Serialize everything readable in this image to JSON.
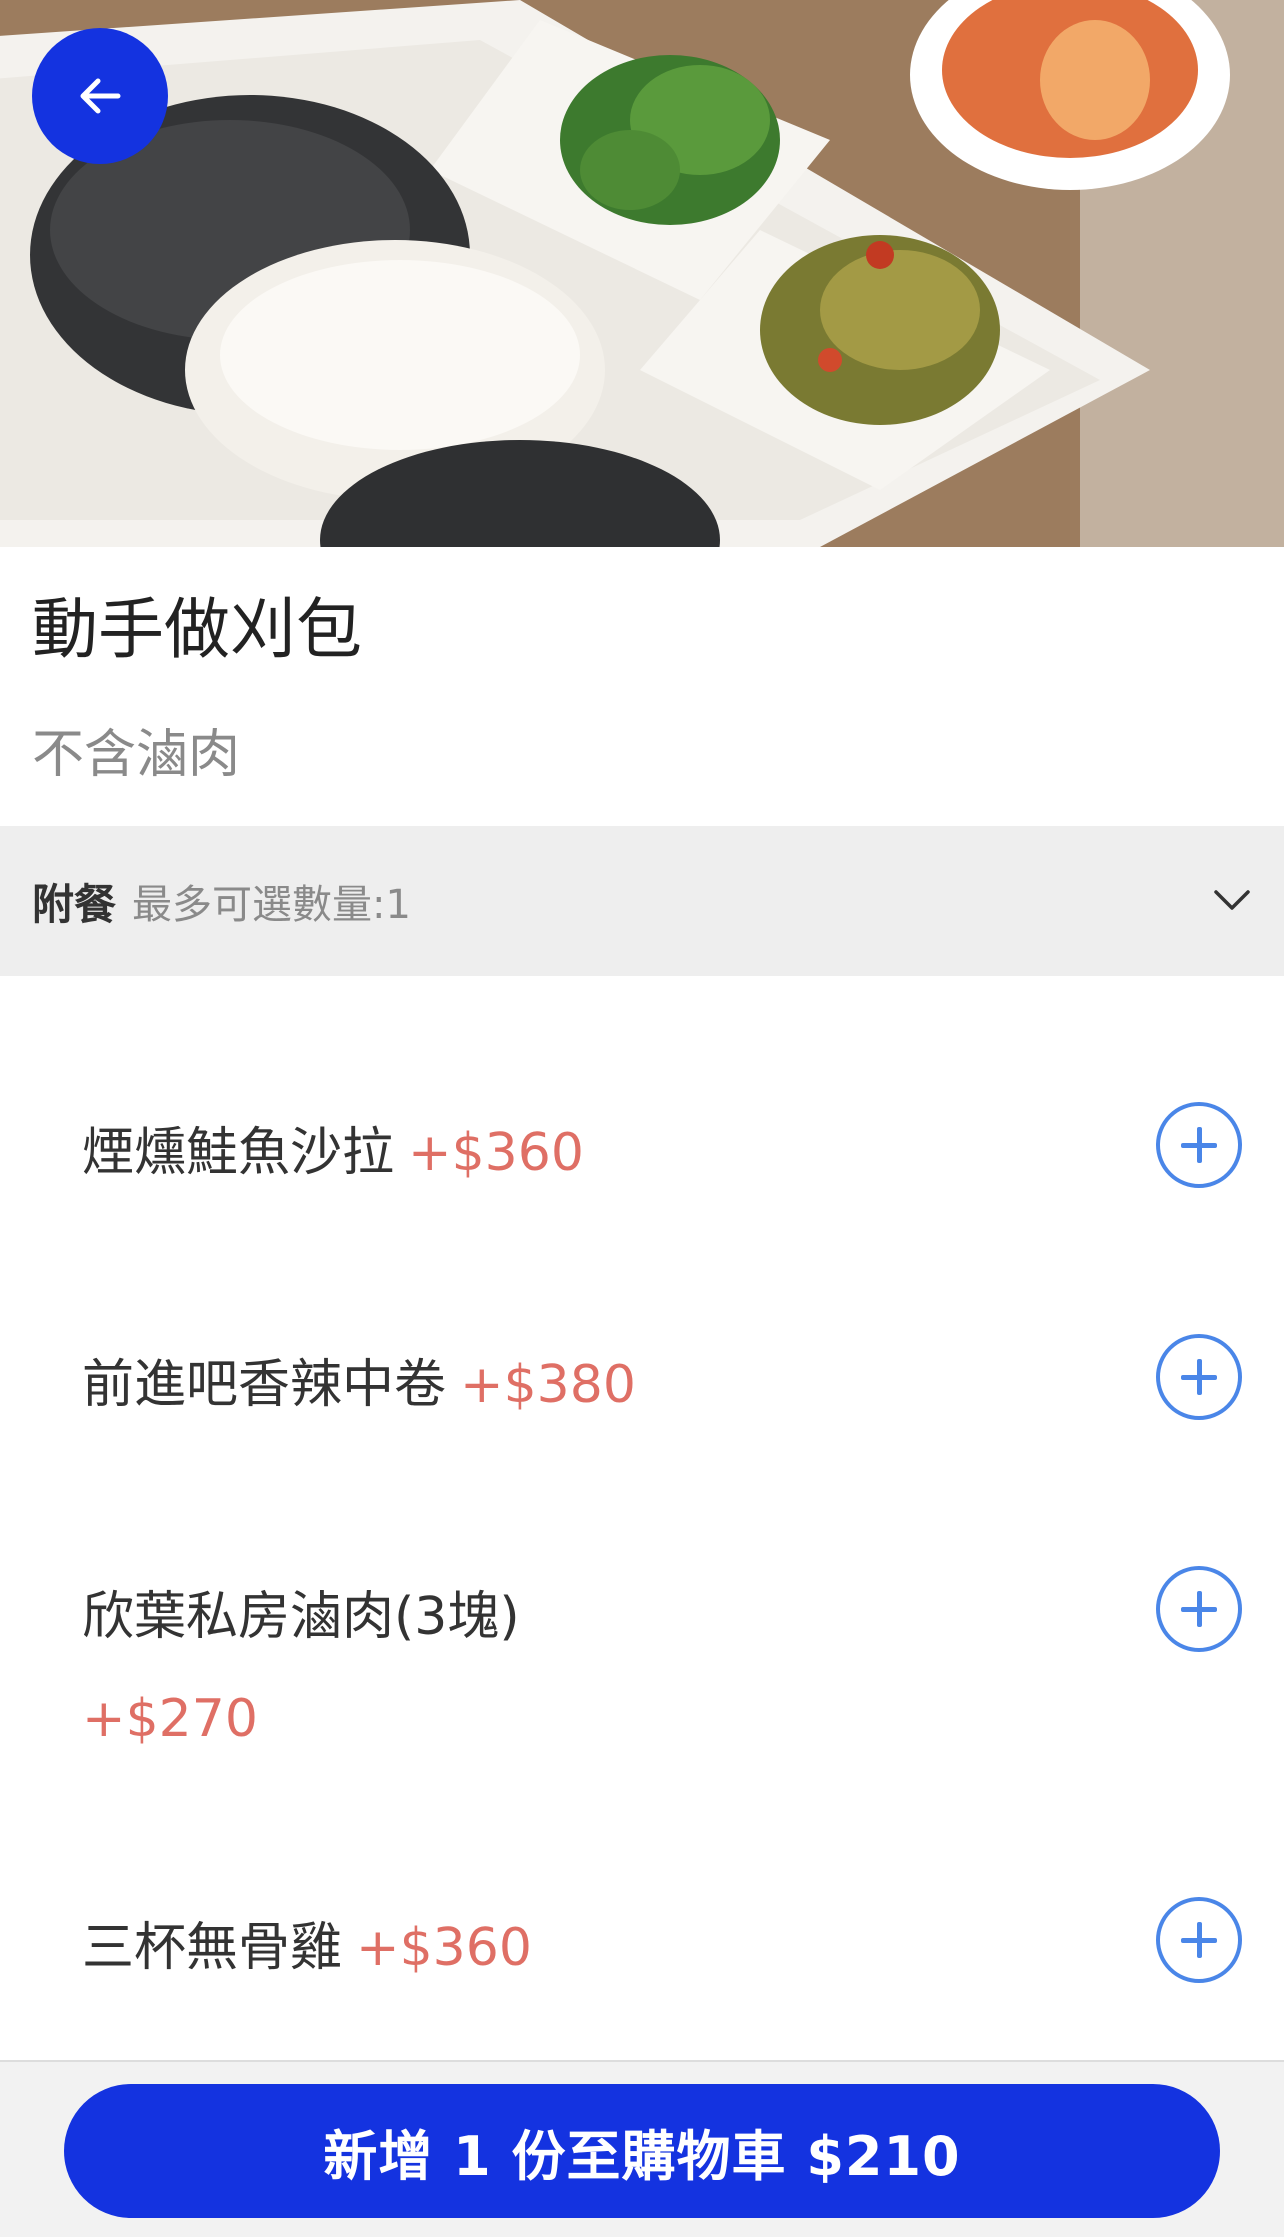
{
  "item": {
    "title": "動手做刈包",
    "description": "不含滷肉"
  },
  "addons_section": {
    "title": "附餐",
    "hint": "最多可選數量:1"
  },
  "options": [
    {
      "name": "煙燻鮭魚沙拉",
      "price": "+$360"
    },
    {
      "name": "前進吧香辣中卷",
      "price": "+$380"
    },
    {
      "name": "欣葉私房滷肉(3塊)",
      "price": "+$270"
    },
    {
      "name": "三杯無骨雞",
      "price": "+$360"
    }
  ],
  "cart_button": {
    "label": "新增 1 份至購物車 $210"
  },
  "icons": {
    "back": "arrow-left-icon",
    "chevron": "chevron-down-icon",
    "add": "plus-circle-icon"
  },
  "colors": {
    "primary": "#1433e0",
    "price": "#df6f65",
    "add_icon": "#4a86e8"
  }
}
